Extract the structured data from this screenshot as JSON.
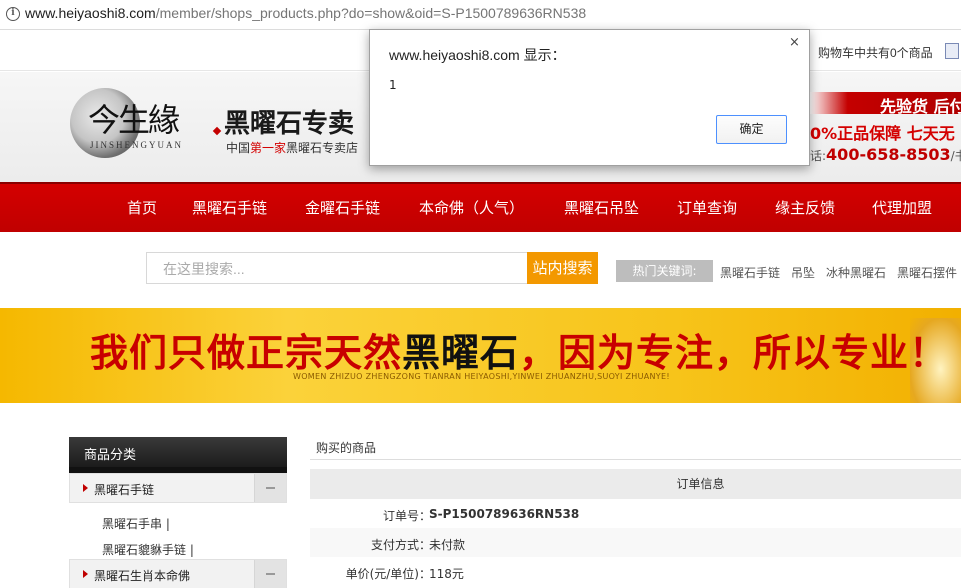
{
  "browser": {
    "url_host": "www.heiyaoshi8.com",
    "url_path": "/member/shops_products.php?do=show&oid=S-P1500789636RN538"
  },
  "topbar": {
    "cart_text": "购物车中共有0个商品"
  },
  "header": {
    "logo_calligraphy": "今生緣",
    "logo_en": "JINSHENGYUAN",
    "title": "黑曜石专卖",
    "sub_prefix": "中国",
    "sub_highlight": "第一家",
    "sub_suffix": "黑曜石专卖店",
    "promo_line1": "先验货 后付",
    "promo_line2": "0%正品保障 七天无",
    "promo_phone_label": "话:",
    "promo_phone": "400-658-8503",
    "promo_phone_suffix": "/书"
  },
  "nav": {
    "items": [
      "首页",
      "黑曜石手链",
      "金曜石手链",
      "本命佛（人气）",
      "黑曜石吊坠",
      "订单查询",
      "缘主反馈",
      "代理加盟"
    ]
  },
  "search": {
    "placeholder": "在这里搜索...",
    "button": "站内搜索",
    "hot_label": "热门关键词:",
    "hot_keywords": [
      "黑曜石手链",
      "吊坠",
      "冰种黑曜石",
      "黑曜石摆件"
    ]
  },
  "banner": {
    "text_part1": "我们只做正宗天然",
    "text_part2": "黑曜石",
    "text_part3": "，因为专注，所以专业！",
    "pinyin": "WOMEN ZHIZUO ZHENGZONG TIANRAN HEIYAOSHI,YINWEI ZHUANZHU,SUOYI ZHUANYE!"
  },
  "sidebar": {
    "header": "商品分类",
    "categories": [
      {
        "label": "黑曜石手链",
        "subs": [
          "黑曜石手串 |",
          "黑曜石貔貅手链 |"
        ]
      },
      {
        "label": "黑曜石生肖本命佛"
      }
    ]
  },
  "order": {
    "section_title": "购买的商品",
    "header": "订单信息",
    "rows": [
      {
        "key": "订单号：",
        "value": "S-P1500789636RN538"
      },
      {
        "key": "支付方式：",
        "value": "未付款"
      },
      {
        "key": "单价(元/单位)：",
        "value": "118元"
      }
    ]
  },
  "dialog": {
    "title": "www.heiyaoshi8.com 显示：",
    "message": "1",
    "close": "×",
    "ok": "确定"
  }
}
